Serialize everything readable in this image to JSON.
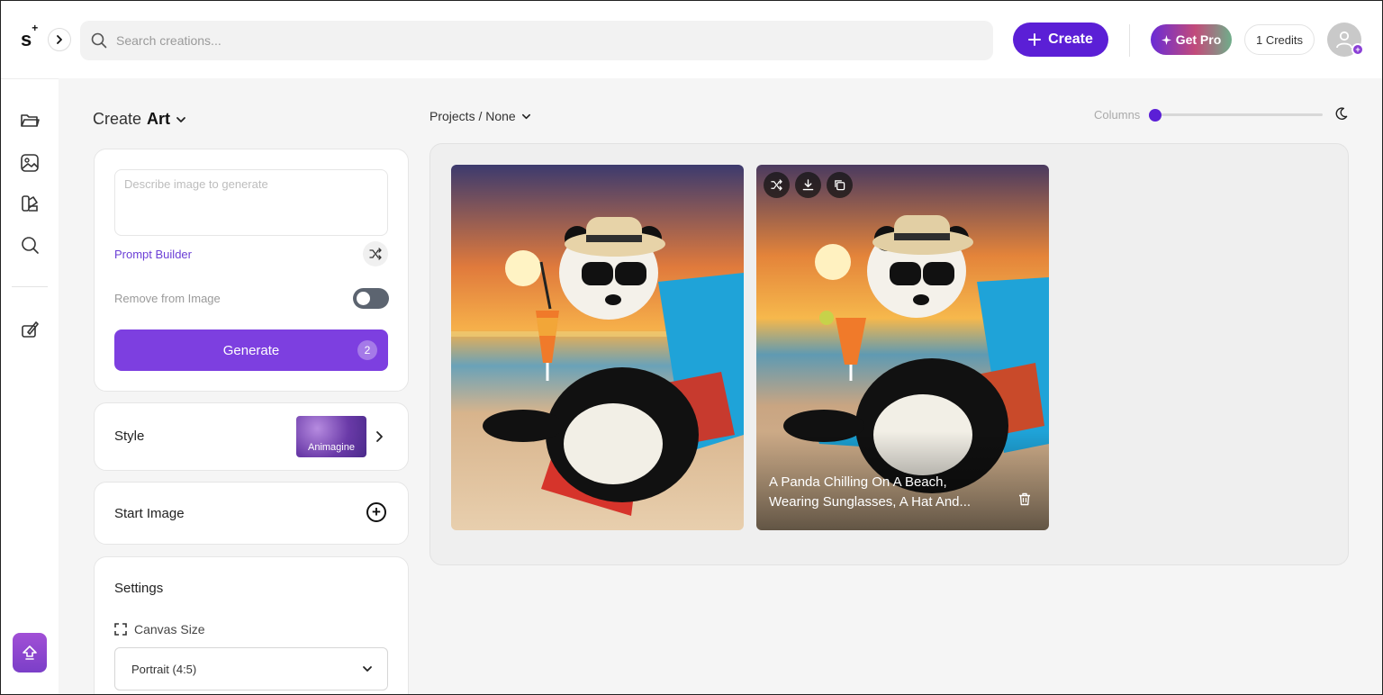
{
  "header": {
    "logo": "s",
    "logo_mark": "+",
    "search_placeholder": "Search creations...",
    "create_label": "Create",
    "get_pro_label": "Get Pro",
    "credits_label": "1 Credits"
  },
  "left_panel": {
    "heading_prefix": "Create",
    "heading_bold": "Art",
    "prompt_placeholder": "Describe image to generate",
    "prompt_value": "",
    "prompt_builder_label": "Prompt Builder",
    "remove_from_image_label": "Remove from Image",
    "remove_from_image_enabled": false,
    "generate_label": "Generate",
    "generate_cost": "2",
    "style_label": "Style",
    "style_selected": "Animagine",
    "start_image_label": "Start Image",
    "settings_label": "Settings",
    "canvas_size_label": "Canvas Size",
    "canvas_size_value": "Portrait (4:5)"
  },
  "main": {
    "breadcrumb": "Projects / None",
    "columns_label": "Columns",
    "columns_value_fraction": 0.0,
    "images": [
      {
        "caption": ""
      },
      {
        "caption": "A Panda Chilling On A Beach, Wearing Sunglasses, A Hat And..."
      }
    ]
  },
  "colors": {
    "brand_purple": "#5b1fd6",
    "generate_purple": "#7d3fe0",
    "link_purple": "#6b3fd6"
  },
  "icons": {
    "rail": [
      "folder-icon",
      "image-icon",
      "palette-icon",
      "search-icon",
      "brush-icon"
    ],
    "card_tools": [
      "shuffle-icon",
      "download-icon",
      "copy-icon"
    ]
  }
}
